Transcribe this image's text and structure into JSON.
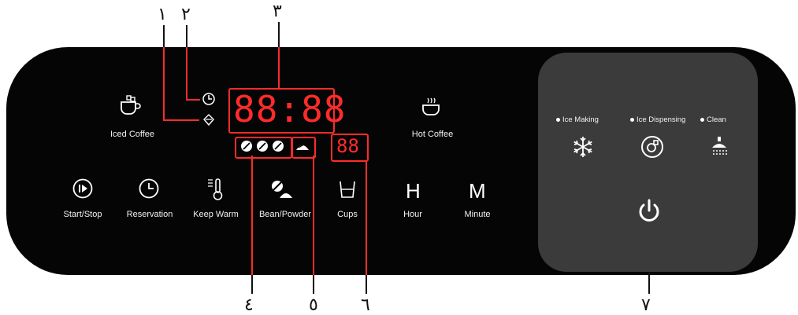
{
  "callouts": {
    "c1": "١",
    "c2": "٢",
    "c3": "٣",
    "c4": "٤",
    "c5": "٥",
    "c6": "٦",
    "c7": "٧"
  },
  "display": {
    "time": "88:88",
    "cups": "88"
  },
  "modes": {
    "iced_coffee": "Iced Coffee",
    "hot_coffee": "Hot Coffee"
  },
  "buttons": {
    "start_stop": "Start/Stop",
    "reservation": "Reservation",
    "keep_warm": "Keep Warm",
    "bean_powder": "Bean/Powder",
    "cups": "Cups",
    "hour": "Hour",
    "hour_symbol": "H",
    "minute": "Minute",
    "minute_symbol": "M"
  },
  "touch_panel": {
    "ice_making": "Ice Making",
    "ice_dispensing": "Ice Dispensing",
    "clean": "Clean"
  },
  "colors": {
    "panel": "#050505",
    "touch_panel": "#3b3b3b",
    "led": "#ff2b2b"
  }
}
